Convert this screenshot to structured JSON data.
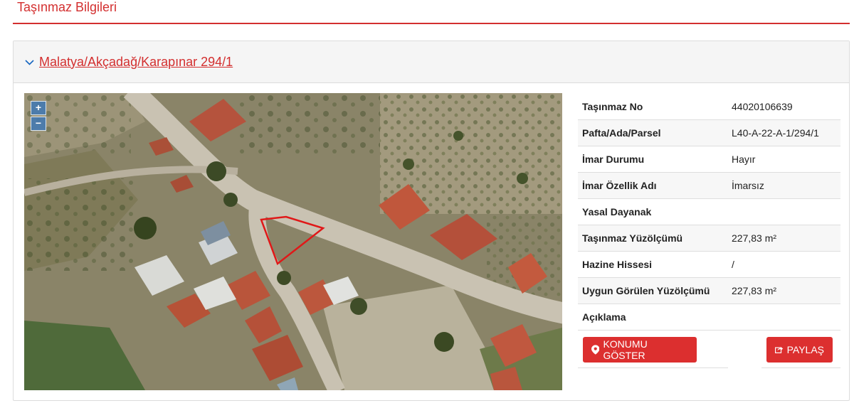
{
  "page": {
    "title": "Taşınmaz Bilgileri",
    "accent_color": "#d32f2f"
  },
  "panel": {
    "heading": "Malatya/Akçadağ/Karapınar 294/1",
    "chevron_icon": "chevron-down-icon"
  },
  "map": {
    "zoom_in": "+",
    "zoom_out": "−"
  },
  "info": {
    "rows": [
      {
        "label": "Taşınmaz No",
        "value": "44020106639"
      },
      {
        "label": "Pafta/Ada/Parsel",
        "value": "L40-A-22-A-1/294/1"
      },
      {
        "label": "İmar Durumu",
        "value": "Hayır"
      },
      {
        "label": "İmar Özellik Adı",
        "value": "İmarsız"
      },
      {
        "label": "Yasal Dayanak",
        "value": ""
      },
      {
        "label": "Taşınmaz Yüzölçümü",
        "value": "227,83 m²"
      },
      {
        "label": "Hazine Hissesi",
        "value": "/"
      },
      {
        "label": "Uygun Görülen Yüzölçümü",
        "value": "227,83 m²"
      },
      {
        "label": "Açıklama",
        "value": ""
      }
    ]
  },
  "actions": {
    "show_location": "KONUMU GÖSTER",
    "share": "PAYLAŞ"
  }
}
